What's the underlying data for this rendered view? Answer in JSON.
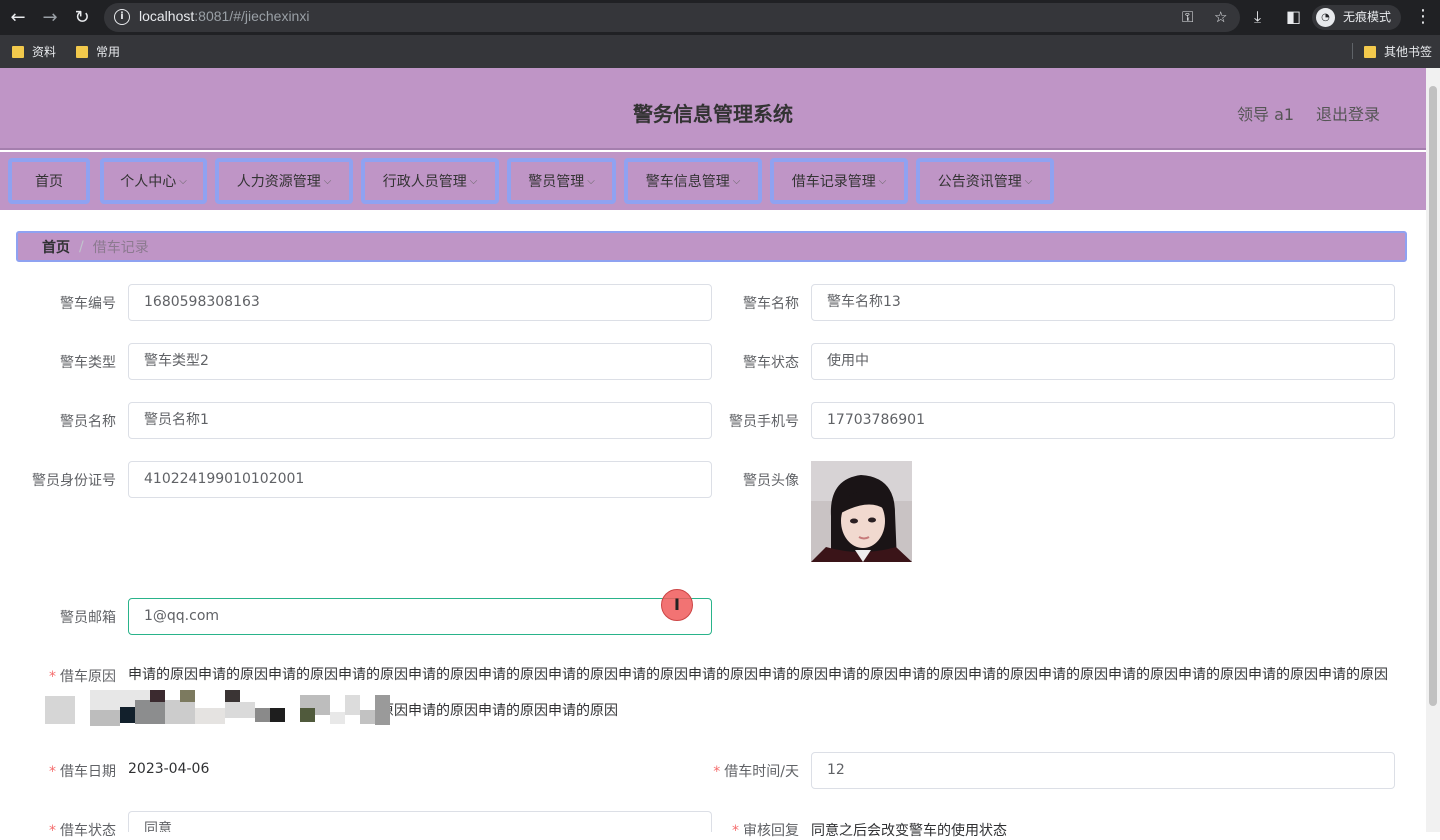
{
  "browser": {
    "url_host": "localhost",
    "url_rest": ":8081/#/jiechexinxi",
    "incognito_label": "无痕模式",
    "bookmarks": [
      "资料",
      "常用"
    ],
    "other_bookmarks": "其他书签"
  },
  "header": {
    "title": "警务信息管理系统",
    "user": "领导 a1",
    "logout": "退出登录"
  },
  "menu": [
    {
      "label": "首页"
    },
    {
      "label": "个人中心"
    },
    {
      "label": "人力资源管理"
    },
    {
      "label": "行政人员管理"
    },
    {
      "label": "警员管理"
    },
    {
      "label": "警车信息管理"
    },
    {
      "label": "借车记录管理"
    },
    {
      "label": "公告资讯管理"
    }
  ],
  "breadcrumb": {
    "home": "首页",
    "sep": "/",
    "current": "借车记录"
  },
  "form": {
    "car_no_label": "警车编号",
    "car_no": "1680598308163",
    "car_name_label": "警车名称",
    "car_name": "警车名称13",
    "car_type_label": "警车类型",
    "car_type": "警车类型2",
    "car_status_label": "警车状态",
    "car_status": "使用中",
    "officer_name_label": "警员名称",
    "officer_name": "警员名称1",
    "officer_phone_label": "警员手机号",
    "officer_phone": "17703786901",
    "officer_id_label": "警员身份证号",
    "officer_id": "410224199010102001",
    "officer_avatar_label": "警员头像",
    "officer_email_label": "警员邮箱",
    "officer_email": "1@qq.com",
    "reason_label": "借车原因",
    "reason_line1": "申请的原因申请的原因申请的原因申请的原因申请的原因申请的原因申请的原因申请的原因申请的原因申请的原因申请的原因申请的原因申请的原因申请的原因申请的原因申请的原因申请的原因申请的原因",
    "reason_line2": "原因申请的原因申请的原因申请的原因",
    "borrow_date_label": "借车日期",
    "borrow_date": "2023-04-06",
    "borrow_days_label": "借车时间/天",
    "borrow_days": "12",
    "borrow_status_label": "借车状态",
    "borrow_status": "同意",
    "review_reply_label": "审核回复",
    "review_reply": "同意之后会改变警车的使用状态"
  },
  "colors": {
    "header_bg": "#bf95c6",
    "menu_border": "#8fa2f1",
    "focus_border": "#29b38a",
    "required": "#f56c6c"
  }
}
